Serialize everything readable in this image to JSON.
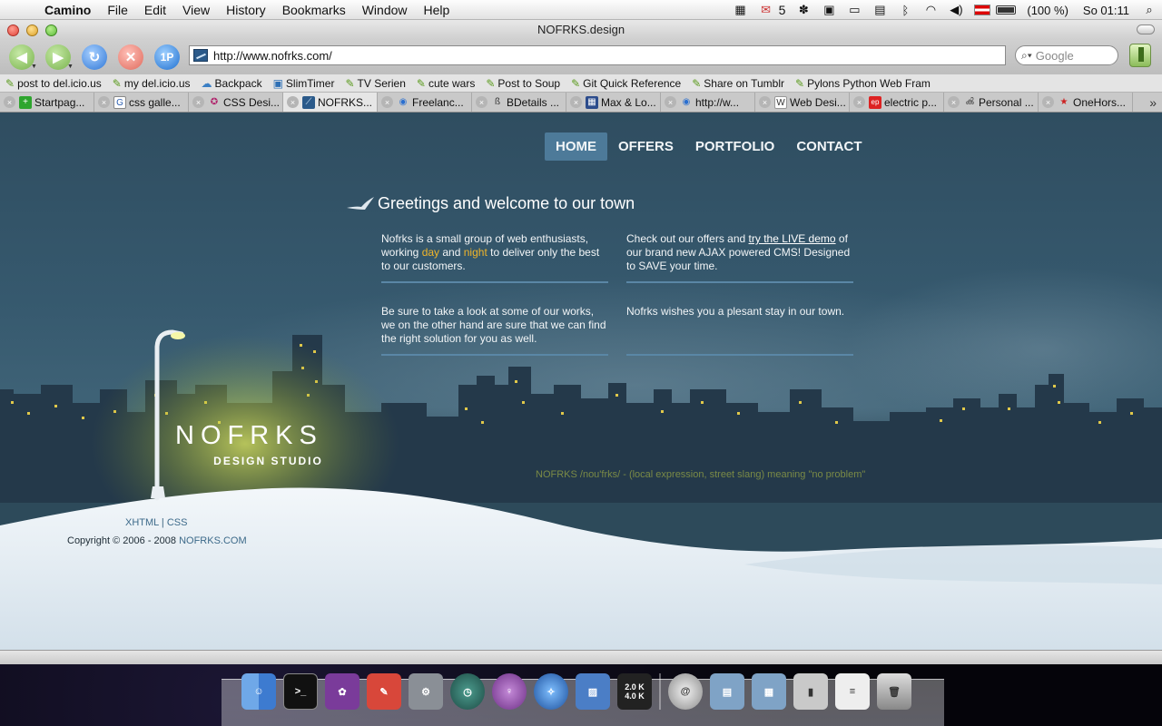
{
  "menubar": {
    "app_name": "Camino",
    "items": [
      "File",
      "Edit",
      "View",
      "History",
      "Bookmarks",
      "Window",
      "Help"
    ],
    "mail_count": "5",
    "battery": "(100 %)",
    "clock": "So 01:11"
  },
  "window": {
    "title": "NOFRKS.design"
  },
  "toolbar": {
    "one_password": "1P",
    "url": "http://www.nofrks.com/",
    "search_placeholder": "Google"
  },
  "bookmarks": [
    "post to del.icio.us",
    "my del.icio.us",
    "Backpack",
    "SlimTimer",
    "TV Serien",
    "cute wars",
    "Post to Soup",
    "Git Quick Reference",
    "Share on Tumblr",
    "Pylons Python Web Fram"
  ],
  "tabs": [
    {
      "label": "Startpag...",
      "active": false
    },
    {
      "label": "css galle...",
      "active": false
    },
    {
      "label": "CSS Desi...",
      "active": false
    },
    {
      "label": "NOFRKS....",
      "active": true
    },
    {
      "label": "Freelanc...",
      "active": false
    },
    {
      "label": "BDetails ...",
      "active": false
    },
    {
      "label": "Max & Lo...",
      "active": false
    },
    {
      "label": "http://w...",
      "active": false
    },
    {
      "label": "Web Desi...",
      "active": false
    },
    {
      "label": "electric p...",
      "active": false
    },
    {
      "label": "Personal ...",
      "active": false
    },
    {
      "label": "OneHors...",
      "active": false
    }
  ],
  "site": {
    "nav": [
      "HOME",
      "OFFERS",
      "PORTFOLIO",
      "CONTACT"
    ],
    "welcome": "Greetings and welcome to our town",
    "col1": {
      "p1_a": "Nofrks is a small group of web enthusiasts, working ",
      "day": "day",
      "and": " and ",
      "night": "night",
      "p1_b": " to deliver only the best to our customers.",
      "p2": "Be sure to take a look at some of our works, we on the other hand are sure that we can find the right solution for you as well."
    },
    "col2": {
      "p1_a": "Check out our offers and ",
      "link": "try the LIVE demo",
      "p1_b": " of our brand new AJAX powered CMS! Designed to SAVE your time.",
      "p2": "Nofrks wishes you a plesant stay in our town."
    },
    "logo_main": "NOFRKS",
    "logo_sub": "DESIGN STUDIO",
    "meaning": "NOFRKS /nou'frks/ - (local expression, street slang) meaning \"no problem\"",
    "footer": {
      "xhtml": "XHTML",
      "sep": " | ",
      "css": "CSS",
      "copyright": "Copyright © 2006 - 2008 ",
      "copyright_link": "NOFRKS.COM"
    }
  },
  "dock": {
    "rates_up": "2.0 K",
    "rates_down": "4.0 K"
  },
  "colors": {
    "page_bg": "#36596e",
    "nav_active": "#4d7a99",
    "highlight": "#f0b52a",
    "snow": "#dbe6ee"
  }
}
